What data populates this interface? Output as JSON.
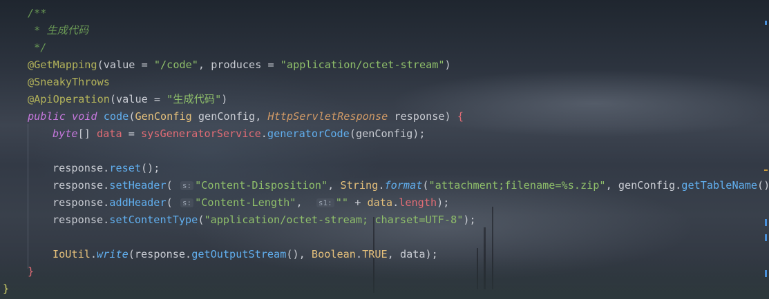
{
  "editor": {
    "lines": [
      "/**",
      " * 生成代码",
      " */",
      "@GetMapping(value = \"/code\", produces = \"application/octet-stream\")",
      "@SneakyThrows",
      "@ApiOperation(value = \"生成代码\")",
      "public void code(GenConfig genConfig, HttpServletResponse response) {",
      "byte[] data = sysGeneratorService.generatorCode(genConfig);",
      "",
      "response.reset();",
      "response.setHeader( s: \"Content-Disposition\", String.format(\"attachment;filename=%s.zip\", genConfig.getTableName()));",
      "response.addHeader( s: \"Content-Length\",  s1: \"\" + data.length);",
      "response.setContentType(\"application/octet-stream; charset=UTF-8\");",
      "",
      "IoUtil.write(response.getOutputStream(), Boolean.TRUE, data);",
      "}",
      "}"
    ],
    "hints": {
      "s": "s:",
      "s1": "s1:"
    }
  },
  "colors": {
    "comment": "#6a9955",
    "annotation": "#b3b35a",
    "string": "#8fbf6a",
    "keyword": "#c678dd",
    "function": "#61afef",
    "type": "#e5c07b"
  }
}
